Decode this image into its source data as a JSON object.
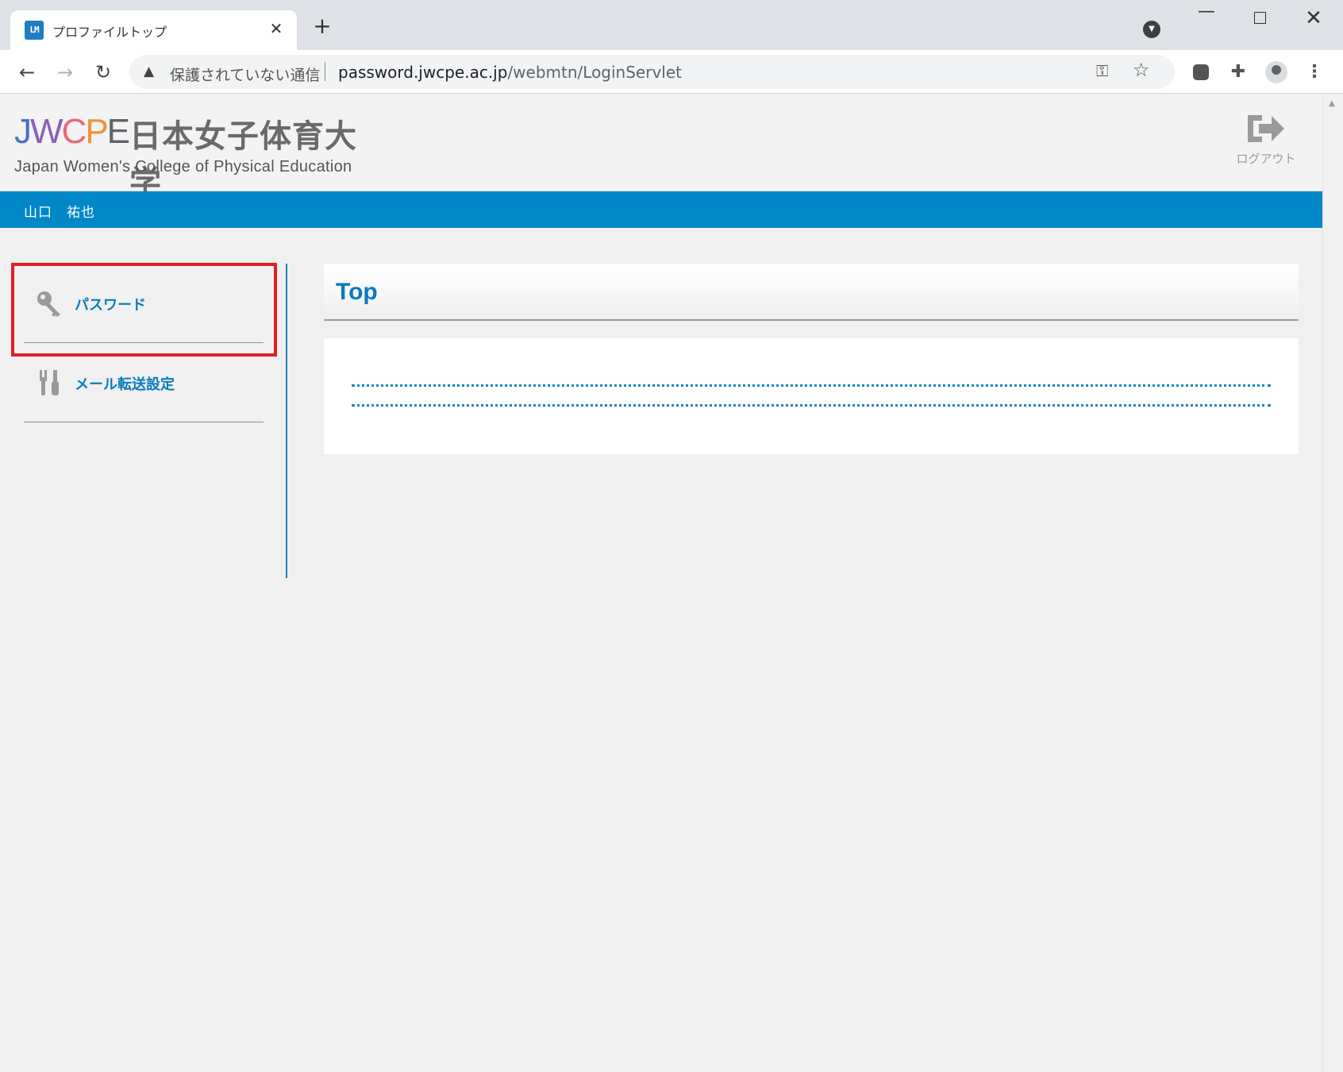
{
  "browser": {
    "tab_title": "プロファイルトップ",
    "tab_favicon_text": "LM",
    "tab_close": "✕",
    "new_tab": "+",
    "security_label": "保護されていない通信",
    "url_host": "password.jwcpe.ac.jp",
    "url_path": "/webmtn/LoginServlet",
    "window_controls": {
      "minimize": "—",
      "close": "✕"
    }
  },
  "header": {
    "logo_mark": [
      "J",
      "W",
      "C",
      "P",
      "E"
    ],
    "logo_jp": "日本女子体育大学",
    "logo_en": "Japan Women's College of Physical Education",
    "logout_label": "ログアウト"
  },
  "user_bar": {
    "user_name": "山口　祐也"
  },
  "sidebar": {
    "items": [
      {
        "label": "パスワード",
        "icon": "key-icon"
      },
      {
        "label": "メール転送設定",
        "icon": "tools-icon"
      }
    ]
  },
  "main": {
    "heading": "Top"
  },
  "colors": {
    "accent": "#0087c8",
    "link": "#0a7bbd",
    "highlight": "#e01f26"
  }
}
